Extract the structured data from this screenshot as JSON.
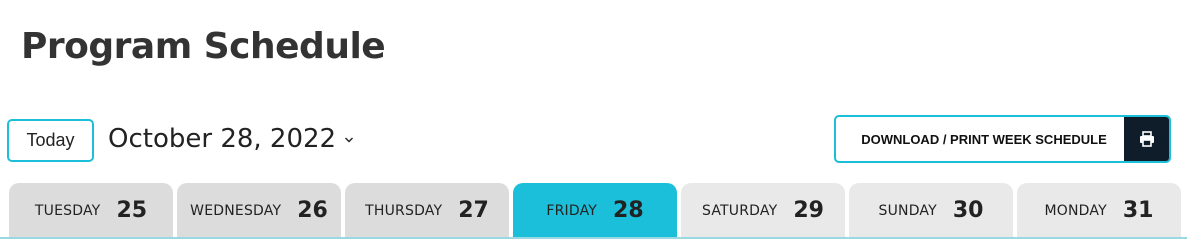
{
  "page": {
    "title": "Program Schedule"
  },
  "toolbar": {
    "today_label": "Today",
    "current_date": "October 28, 2022",
    "download_label": "DOWNLOAD / PRINT WEEK SCHEDULE"
  },
  "days": [
    {
      "day": "TUESDAY",
      "date": "25",
      "active": false
    },
    {
      "day": "WEDNESDAY",
      "date": "26",
      "active": false
    },
    {
      "day": "THURSDAY",
      "date": "27",
      "active": false
    },
    {
      "day": "FRIDAY",
      "date": "28",
      "active": true
    },
    {
      "day": "SATURDAY",
      "date": "29",
      "active": false
    },
    {
      "day": "SUNDAY",
      "date": "30",
      "active": false
    },
    {
      "day": "MONDAY",
      "date": "31",
      "active": false
    }
  ],
  "colors": {
    "accent": "#1bbfd9",
    "dark_button": "#0f1d2b",
    "tab_bg": "#dcdcdc"
  },
  "icons": {
    "date_dropdown": "chevron-down-icon",
    "print": "printer-icon"
  }
}
